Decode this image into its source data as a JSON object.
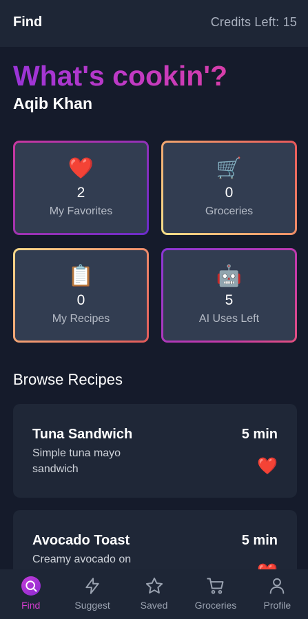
{
  "header": {
    "title": "Find",
    "credits": "Credits Left: 15"
  },
  "hero": {
    "headline": "What's cookin'?",
    "user_name": "Aqib Khan"
  },
  "stats": [
    {
      "icon": "heart-icon",
      "glyph": "❤️",
      "count": "2",
      "label": "My Favorites"
    },
    {
      "icon": "cart-icon",
      "glyph": "🛒",
      "count": "0",
      "label": "Groceries"
    },
    {
      "icon": "clipboard-icon",
      "glyph": "📋",
      "count": "0",
      "label": "My Recipes"
    },
    {
      "icon": "robot-icon",
      "glyph": "🤖",
      "count": "5",
      "label": "AI Uses Left"
    }
  ],
  "browse": {
    "title": "Browse Recipes",
    "recipes": [
      {
        "name": "Tuna Sandwich",
        "time": "5 min",
        "description": "Simple tuna mayo sandwich",
        "favorite_icon": "heart-icon",
        "favorite_glyph": "❤️"
      },
      {
        "name": "Avocado Toast",
        "time": "5 min",
        "description": "Creamy avocado on",
        "favorite_icon": "heart-icon",
        "favorite_glyph": "❤️"
      }
    ]
  },
  "nav": {
    "items": [
      {
        "label": "Find",
        "icon": "search-icon",
        "active": true
      },
      {
        "label": "Suggest",
        "icon": "lightning-icon"
      },
      {
        "label": "Saved",
        "icon": "star-icon"
      },
      {
        "label": "Groceries",
        "icon": "cart-icon"
      },
      {
        "label": "Profile",
        "icon": "user-icon"
      }
    ]
  },
  "colors": {
    "background": "#151b2b",
    "card": "#323d51",
    "panel": "#1e2636",
    "accent": "#d53ed0"
  }
}
